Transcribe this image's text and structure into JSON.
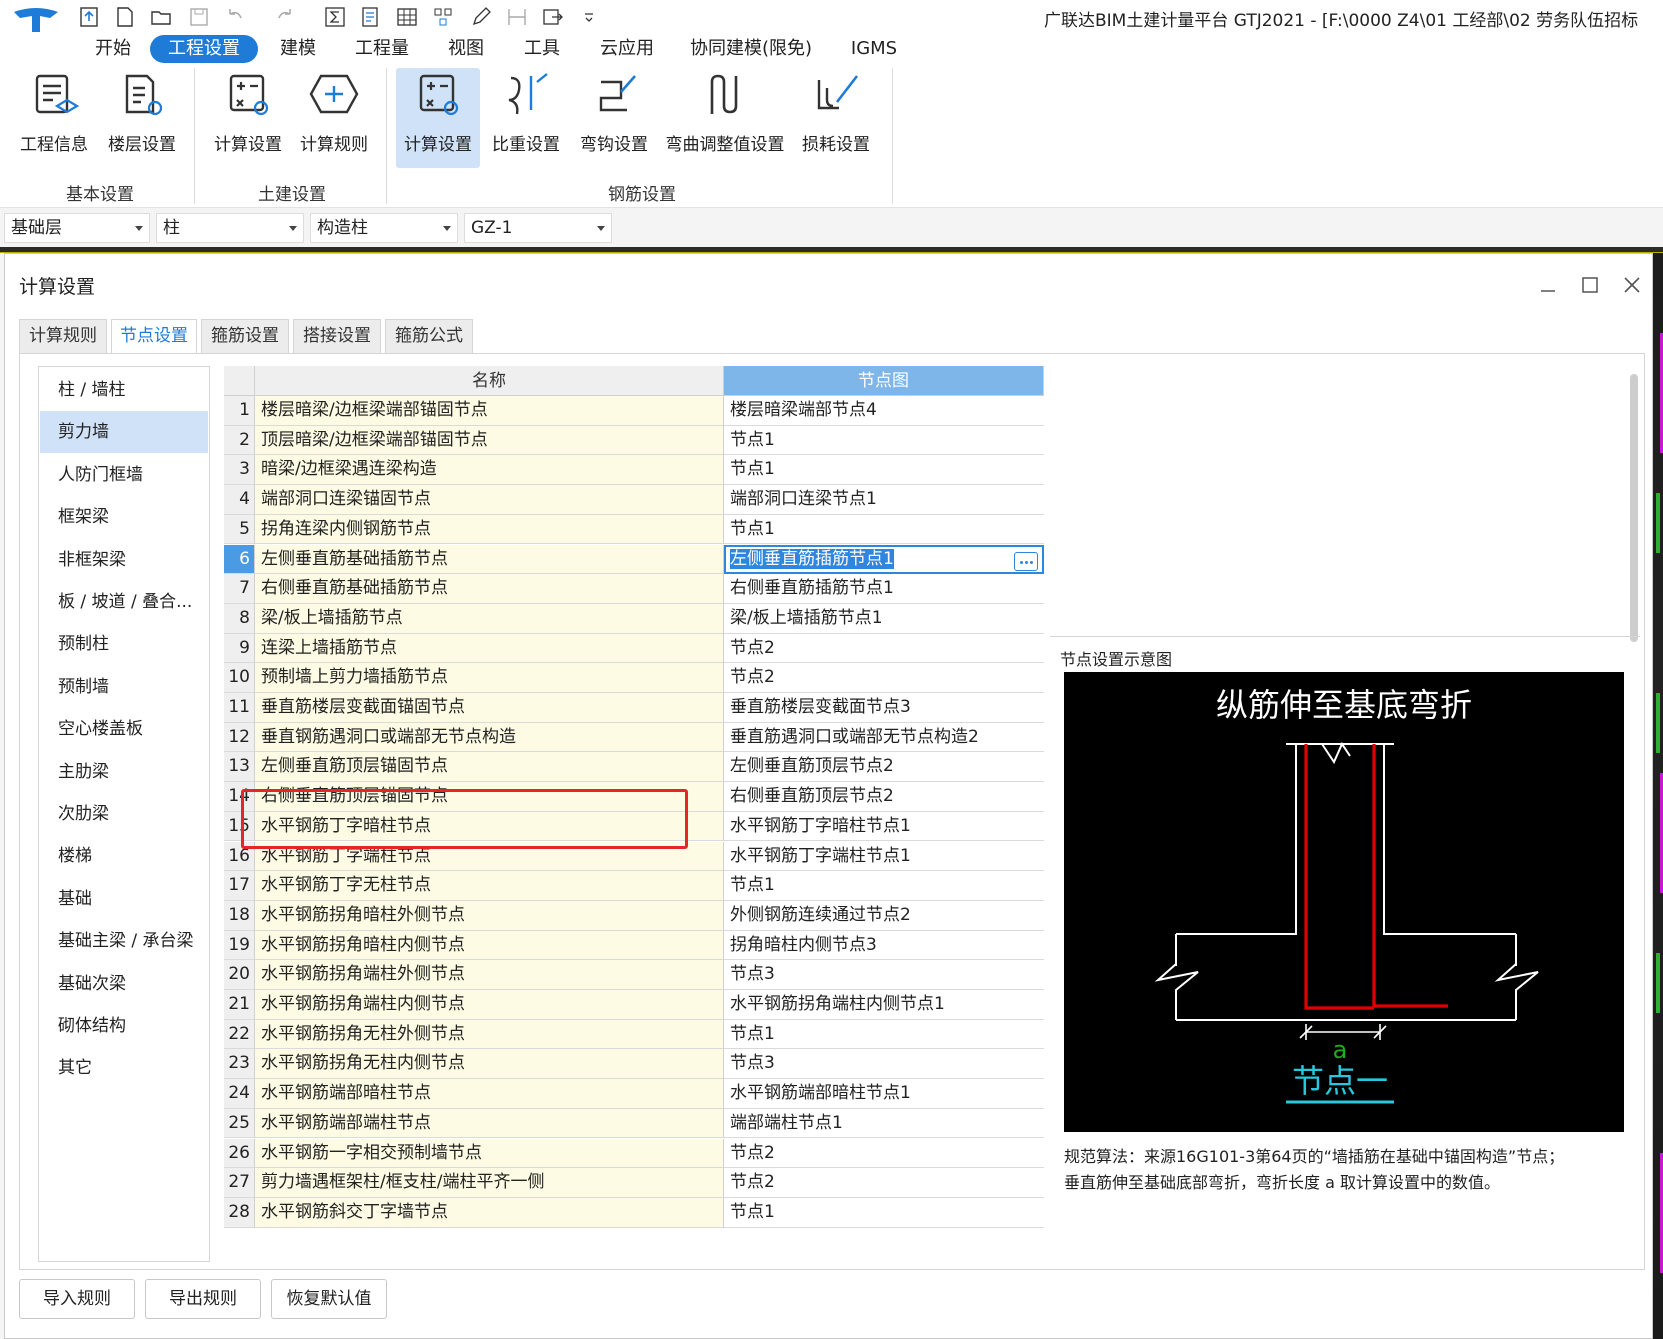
{
  "app": {
    "window_title": "广联达BIM土建计量平台 GTJ2021 - [F:\\0000 Z4\\01 工经部\\02 劳务队伍招标"
  },
  "menu": {
    "tabs": [
      "开始",
      "工程设置",
      "建模",
      "工程量",
      "视图",
      "工具",
      "云应用",
      "协同建模(限免)",
      "IGMS"
    ],
    "active": "工程设置"
  },
  "ribbon": {
    "buttons": [
      "工程信息",
      "楼层设置",
      "计算设置",
      "计算规则",
      "计算设置",
      "比重设置",
      "弯钩设置",
      "弯曲调整值设置",
      "损耗设置"
    ],
    "groups": [
      "基本设置",
      "土建设置",
      "钢筋设置"
    ]
  },
  "selectors": [
    "基础层",
    "柱",
    "构造柱",
    "GZ-1"
  ],
  "dialog": {
    "title": "计算设置",
    "tabs": [
      "计算规则",
      "节点设置",
      "箍筋设置",
      "搭接设置",
      "箍筋公式"
    ],
    "active_tab": "节点设置",
    "categories": [
      "柱 / 墙柱",
      "剪力墙",
      "人防门框墙",
      "框架梁",
      "非框架梁",
      "板 / 坡道 / 叠合...",
      "预制柱",
      "预制墙",
      "空心楼盖板",
      "主肋梁",
      "次肋梁",
      "楼梯",
      "基础",
      "基础主梁 / 承台梁",
      "基础次梁",
      "砌体结构",
      "其它"
    ],
    "active_category": "剪力墙",
    "columns": {
      "name": "名称",
      "node": "节点图"
    },
    "rows": [
      {
        "no": "1",
        "name": "楼层暗梁/边框梁端部锚固节点",
        "node": "楼层暗梁端部节点4"
      },
      {
        "no": "2",
        "name": "顶层暗梁/边框梁端部锚固节点",
        "node": "节点1"
      },
      {
        "no": "3",
        "name": "暗梁/边框梁遇连梁构造",
        "node": "节点1"
      },
      {
        "no": "4",
        "name": "端部洞口连梁锚固节点",
        "node": "端部洞口连梁节点1"
      },
      {
        "no": "5",
        "name": "拐角连梁内侧钢筋节点",
        "node": "节点1"
      },
      {
        "no": "6",
        "name": "左侧垂直筋基础插筋节点",
        "node": "左侧垂直筋插筋节点1"
      },
      {
        "no": "7",
        "name": "右侧垂直筋基础插筋节点",
        "node": "右侧垂直筋插筋节点1"
      },
      {
        "no": "8",
        "name": "梁/板上墙插筋节点",
        "node": "梁/板上墙插筋节点1"
      },
      {
        "no": "9",
        "name": "连梁上墙插筋节点",
        "node": "节点2"
      },
      {
        "no": "10",
        "name": "预制墙上剪力墙插筋节点",
        "node": "节点2"
      },
      {
        "no": "11",
        "name": "垂直筋楼层变截面锚固节点",
        "node": "垂直筋楼层变截面节点3"
      },
      {
        "no": "12",
        "name": "垂直钢筋遇洞口或端部无节点构造",
        "node": "垂直筋遇洞口或端部无节点构造2"
      },
      {
        "no": "13",
        "name": "左侧垂直筋顶层锚固节点",
        "node": "左侧垂直筋顶层节点2"
      },
      {
        "no": "14",
        "name": "右侧垂直筋顶层锚固节点",
        "node": "右侧垂直筋顶层节点2"
      },
      {
        "no": "15",
        "name": "水平钢筋丁字暗柱节点",
        "node": "水平钢筋丁字暗柱节点1"
      },
      {
        "no": "16",
        "name": "水平钢筋丁字端柱节点",
        "node": "水平钢筋丁字端柱节点1"
      },
      {
        "no": "17",
        "name": "水平钢筋丁字无柱节点",
        "node": "节点1"
      },
      {
        "no": "18",
        "name": "水平钢筋拐角暗柱外侧节点",
        "node": "外侧钢筋连续通过节点2"
      },
      {
        "no": "19",
        "name": "水平钢筋拐角暗柱内侧节点",
        "node": "拐角暗柱内侧节点3"
      },
      {
        "no": "20",
        "name": "水平钢筋拐角端柱外侧节点",
        "node": "节点3"
      },
      {
        "no": "21",
        "name": "水平钢筋拐角端柱内侧节点",
        "node": "水平钢筋拐角端柱内侧节点1"
      },
      {
        "no": "22",
        "name": "水平钢筋拐角无柱外侧节点",
        "node": "节点1"
      },
      {
        "no": "23",
        "name": "水平钢筋拐角无柱内侧节点",
        "node": "节点3"
      },
      {
        "no": "24",
        "name": "水平钢筋端部暗柱节点",
        "node": "水平钢筋端部暗柱节点1"
      },
      {
        "no": "25",
        "name": "水平钢筋端部端柱节点",
        "node": "端部端柱节点1"
      },
      {
        "no": "26",
        "name": "水平钢筋一字相交预制墙节点",
        "node": "节点2"
      },
      {
        "no": "27",
        "name": "剪力墙遇框架柱/框支柱/端柱平齐一侧",
        "node": "节点2"
      },
      {
        "no": "28",
        "name": "水平钢筋斜交丁字墙节点",
        "node": "节点1"
      }
    ],
    "selected_row": "6",
    "preview": {
      "label": "节点设置示意图",
      "heading": "纵筋伸至基底弯折",
      "dim_label": "a",
      "caption": "节点一",
      "description_line1": "规范算法：来源16G101-3第64页的“墙插筋在基础中锚固构造”节点；",
      "description_line2": "垂直筋伸至基础底部弯折，弯折长度 a 取计算设置中的数值。"
    },
    "footer_buttons": [
      "导入规则",
      "导出规则",
      "恢复默认值"
    ]
  },
  "colors": {
    "accent": "#1e7bd8",
    "selection": "#cfe2f7",
    "highlight_box": "#e32626",
    "rebar": "#e00000",
    "caption": "#27c7dd",
    "dim_label": "#19b019"
  }
}
